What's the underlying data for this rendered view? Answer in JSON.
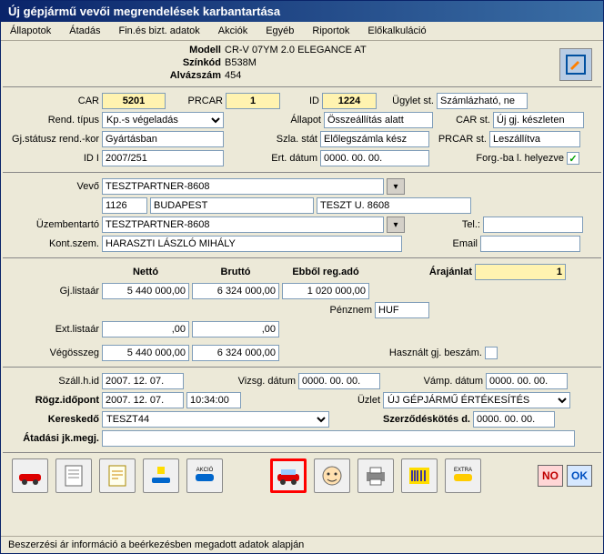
{
  "window_title": "Új gépjármű vevői megrendelések karbantartása",
  "menu": [
    "Állapotok",
    "Átadás",
    "Fin.és bizt. adatok",
    "Akciók",
    "Egyéb",
    "Riportok",
    "Előkalkuláció"
  ],
  "hdr": {
    "modell_lbl": "Modell",
    "modell": "CR-V 07YM 2.0 ELEGANCE AT",
    "szinkod_lbl": "Színkód",
    "szinkod": "B538M",
    "alvazszam_lbl": "Alvázszám",
    "alvazszam": "454"
  },
  "r1": {
    "car_lbl": "CAR",
    "car": "5201",
    "prcar_lbl": "PRCAR",
    "prcar": "1",
    "id_lbl": "ID",
    "id": "1224",
    "ugylet_lbl": "Ügylet st.",
    "ugylet": "Számlázható, ne"
  },
  "r2": {
    "rendtip_lbl": "Rend. típus",
    "rendtip": "Kp.-s végeladás",
    "allapot_lbl": "Állapot",
    "allapot": "Összeállítás alatt",
    "carst_lbl": "CAR st.",
    "carst": "Új gj. készleten"
  },
  "r3": {
    "gjstat_lbl": "Gj.státusz rend.-kor",
    "gjstat": "Gyártásban",
    "szlastat_lbl": "Szla. stát",
    "szlastat": "Előlegszámla kész",
    "prcarst_lbl": "PRCAR st.",
    "prcarst": "Leszállítva"
  },
  "r4": {
    "idi_lbl": "ID I",
    "idi": "2007/251",
    "ertdat_lbl": "Ert. dátum",
    "ertdat": "0000. 00. 00.",
    "forg_lbl": "Forg.-ba l. helyezve"
  },
  "vevo": {
    "lbl": "Vevő",
    "name": "TESZTPARTNER-8608",
    "zip": "1126",
    "city": "BUDAPEST",
    "addr": "TESZT U. 8608"
  },
  "uzem": {
    "lbl": "Üzembentartó",
    "name": "TESZTPARTNER-8608",
    "tel_lbl": "Tel.:",
    "tel": ""
  },
  "kont": {
    "lbl": "Kont.szem.",
    "name": "HARASZTI LÁSZLÓ MIHÁLY",
    "email_lbl": "Email",
    "email": ""
  },
  "prices": {
    "netto_lbl": "Nettó",
    "brutto_lbl": "Bruttó",
    "regado_lbl": "Ebből reg.adó",
    "arajanlat_lbl": "Árajánlat",
    "arajanlat": "1",
    "gjlista_lbl": "Gj.listaár",
    "gj_net": "5 440 000,00",
    "gj_br": "6 324 000,00",
    "gj_reg": "1 020 000,00",
    "penznem_lbl": "Pénznem",
    "penznem": "HUF",
    "extlista_lbl": "Ext.listaár",
    "ext_net": ",00",
    "ext_br": ",00",
    "veg_lbl": "Végösszeg",
    "veg_net": "5 440 000,00",
    "veg_br": "6 324 000,00",
    "hasznalt_lbl": "Használt gj. beszám."
  },
  "dates": {
    "szall_lbl": "Száll.h.id",
    "szall": "2007. 12. 07.",
    "vizsg_lbl": "Vizsg. dátum",
    "vizsg": "0000. 00. 00.",
    "vamp_lbl": "Vámp. dátum",
    "vamp": "0000. 00. 00.",
    "rogz_lbl": "Rögz.időpont",
    "rogz_d": "2007. 12. 07.",
    "rogz_t": "10:34:00",
    "uzlet_lbl": "Üzlet",
    "uzlet": "ÚJ GÉPJÁRMŰ ÉRTÉKESÍTÉS",
    "keresk_lbl": "Kereskedő",
    "keresk": "TESZT44",
    "szerz_lbl": "Szerződéskötés d.",
    "szerz": "0000. 00. 00.",
    "atad_lbl": "Átadási jk.megj.",
    "atad": ""
  },
  "status": "Beszerzési ár információ a beérkezésben megadott adatok alapján",
  "btns": {
    "no": "NO",
    "ok": "OK"
  }
}
